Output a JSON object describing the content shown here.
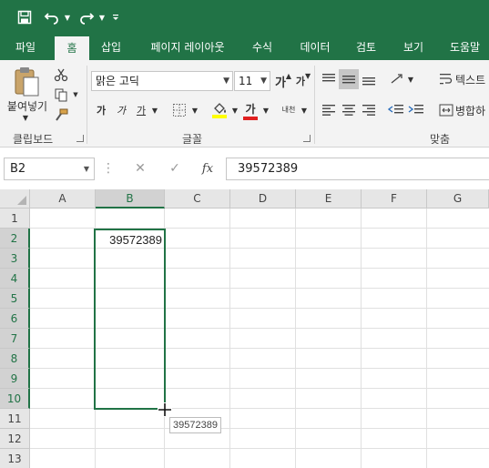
{
  "quick_access": {
    "save_icon": "save-icon",
    "undo_icon": "undo-icon",
    "redo_icon": "redo-icon",
    "customize_icon": "customize-qat-icon"
  },
  "tabs": [
    "파일",
    "홈",
    "삽입",
    "페이지 레이아웃",
    "수식",
    "데이터",
    "검토",
    "보기",
    "도움말"
  ],
  "active_tab": "홈",
  "ribbon": {
    "clipboard": {
      "paste_label": "붙여넣기",
      "group_label": "클립보드"
    },
    "font": {
      "font_name": "맑은 고딕",
      "font_size": "11",
      "bold": "가",
      "italic": "가",
      "underline": "가",
      "font_color_glyph": "가",
      "phonetic": "내천",
      "grow_glyph": "가",
      "shrink_glyph": "가",
      "group_label": "글꼴"
    },
    "alignment": {
      "wrap_text_label": "텍스트",
      "merge_label": "병합하",
      "group_label": "맞춤"
    }
  },
  "formula_bar": {
    "name_box": "B2",
    "fx": "fx",
    "value": "39572389"
  },
  "grid": {
    "columns": [
      "A",
      "B",
      "C",
      "D",
      "E",
      "F",
      "G"
    ],
    "selected_column": "B",
    "rows": [
      "1",
      "2",
      "3",
      "4",
      "5",
      "6",
      "7",
      "8",
      "9",
      "10",
      "11",
      "12",
      "13"
    ],
    "cell_b2": "39572389",
    "fill_tooltip": "39572389"
  },
  "colors": {
    "accent": "#217346",
    "highlight_yellow": "#ffff00",
    "font_red": "#e02020"
  }
}
